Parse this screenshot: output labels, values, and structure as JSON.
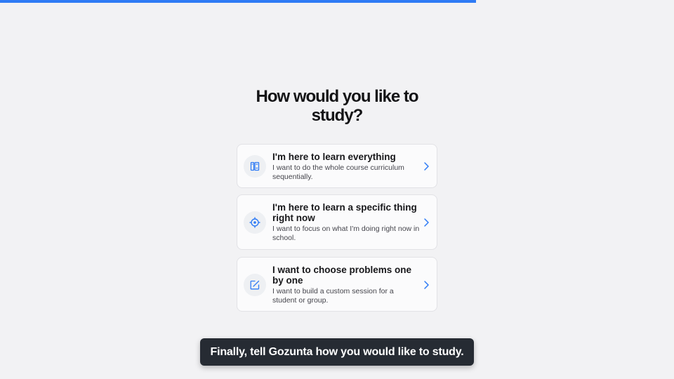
{
  "progress": {
    "percent": 70.6,
    "color": "#2f7bf5"
  },
  "page": {
    "title": "How would you like to study?"
  },
  "options": [
    {
      "icon": "book-icon",
      "heading": "I'm here to learn everything",
      "description": "I want to do the whole course curriculum sequentially."
    },
    {
      "icon": "target-icon",
      "heading": "I'm here to learn a specific thing right now",
      "description": "I want to focus on what I'm doing right now in school."
    },
    {
      "icon": "edit-square-icon",
      "heading": "I want to choose problems one by one",
      "description": "I want to build a custom session for a student or group."
    }
  ],
  "toast": {
    "message": "Finally, tell Gozunta how you would like to study."
  },
  "colors": {
    "accent": "#2f7bf5",
    "background": "#f2f2f4",
    "toast_bg": "#262b33"
  }
}
